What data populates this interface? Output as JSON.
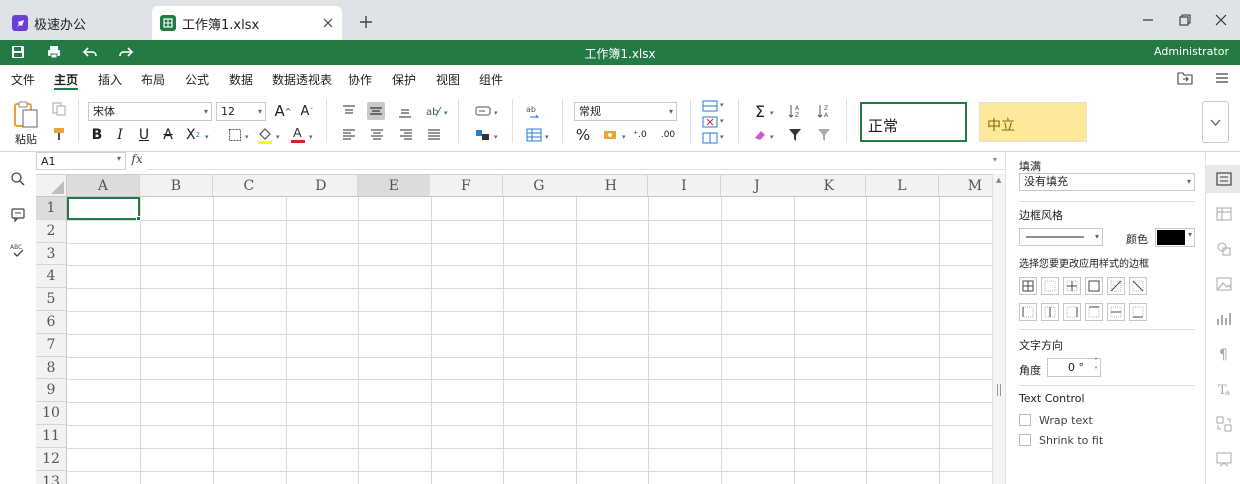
{
  "tabs": {
    "home_label": "极速办公",
    "file_label": "工作簿1.xlsx"
  },
  "title_bar": {
    "doc_title": "工作簿1.xlsx",
    "user": "Administrator"
  },
  "menu": {
    "items": [
      "文件",
      "主页",
      "插入",
      "布局",
      "公式",
      "数据",
      "数据透视表",
      "协作",
      "保护",
      "视图",
      "组件"
    ],
    "active": "主页"
  },
  "ribbon": {
    "paste_label": "粘贴",
    "font_name": "宋体",
    "font_size": "12",
    "number_format": "常规",
    "cell_styles": {
      "normal": "正常",
      "neutral": "中立"
    }
  },
  "formula_bar": {
    "name_box": "A1",
    "fx_label": "fx",
    "formula": ""
  },
  "grid": {
    "columns": [
      "A",
      "B",
      "C",
      "D",
      "E",
      "F",
      "G",
      "H",
      "I",
      "J",
      "K",
      "L",
      "M"
    ],
    "rows": [
      "1",
      "2",
      "3",
      "4",
      "5",
      "6",
      "7",
      "8",
      "9",
      "10",
      "11",
      "12",
      "13"
    ],
    "selected_cell": "A1"
  },
  "panel": {
    "fill_label": "填满",
    "fill_value": "没有填充",
    "border_style_label": "边框风格",
    "color_label": "颜色",
    "border_color": "#000000",
    "border_hint": "选择您要更改应用样式的边框",
    "text_direction_label": "文字方向",
    "angle_label": "角度",
    "angle_value": "0 °",
    "text_control_label": "Text Control",
    "wrap_text": "Wrap text",
    "shrink_to_fit": "Shrink to fit"
  },
  "colors": {
    "brand_green": "#237a44",
    "neutral_fill": "#fee99a"
  }
}
